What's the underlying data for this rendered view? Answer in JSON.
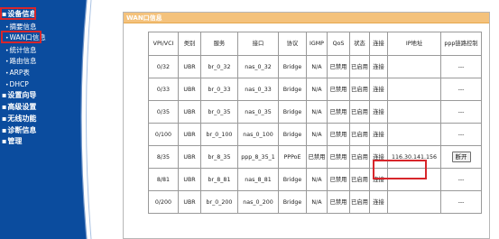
{
  "sidebar": {
    "items": [
      {
        "label": "设备信息",
        "level": "top",
        "bullet": "▪"
      },
      {
        "label": "摘要信息",
        "level": "sub",
        "bullet": "•"
      },
      {
        "label": "WAN口信息",
        "level": "sub",
        "bullet": "•"
      },
      {
        "label": "统计信息",
        "level": "sub",
        "bullet": "•"
      },
      {
        "label": "路由信息",
        "level": "sub",
        "bullet": "•"
      },
      {
        "label": "ARP表",
        "level": "sub",
        "bullet": "•"
      },
      {
        "label": "DHCP",
        "level": "sub",
        "bullet": "•"
      },
      {
        "label": "设置向导",
        "level": "top",
        "bullet": "▪"
      },
      {
        "label": "高级设置",
        "level": "top",
        "bullet": "▪"
      },
      {
        "label": "无线功能",
        "level": "top",
        "bullet": "▪"
      },
      {
        "label": "诊断信息",
        "level": "top",
        "bullet": "▪"
      },
      {
        "label": "管理",
        "level": "top",
        "bullet": "▪"
      }
    ]
  },
  "panel": {
    "title": "WAN口信息"
  },
  "table": {
    "headers": [
      "VPI/VCI",
      "类别",
      "服务",
      "接口",
      "协议",
      "IGMP",
      "QoS",
      "状态",
      "连接",
      "IP地址",
      "ppp链路控制"
    ],
    "rows": [
      [
        "0/32",
        "UBR",
        "br_0_32",
        "nas_0_32",
        "Bridge",
        "N/A",
        "已禁用",
        "已启用",
        "连接",
        "",
        "---"
      ],
      [
        "0/33",
        "UBR",
        "br_0_33",
        "nas_0_33",
        "Bridge",
        "N/A",
        "已禁用",
        "已启用",
        "连接",
        "",
        "---"
      ],
      [
        "0/35",
        "UBR",
        "br_0_35",
        "nas_0_35",
        "Bridge",
        "N/A",
        "已禁用",
        "已启用",
        "连接",
        "",
        "---"
      ],
      [
        "0/100",
        "UBR",
        "br_0_100",
        "nas_0_100",
        "Bridge",
        "N/A",
        "已禁用",
        "已启用",
        "连接",
        "",
        "---"
      ],
      [
        "8/35",
        "UBR",
        "br_8_35",
        "ppp_8_35_1",
        "PPPoE",
        "已禁用",
        "已禁用",
        "已启用",
        "连接",
        "116.30.141.156",
        "断开"
      ],
      [
        "8/81",
        "UBR",
        "br_8_81",
        "nas_8_81",
        "Bridge",
        "N/A",
        "已禁用",
        "已启用",
        "连接",
        "",
        "---"
      ],
      [
        "0/200",
        "UBR",
        "br_0_200",
        "nas_0_200",
        "Bridge",
        "N/A",
        "已禁用",
        "已启用",
        "连接",
        "",
        "---"
      ]
    ]
  },
  "colors": {
    "sidebar": "#0b4c9e",
    "accent": "#f4c27c",
    "highlight": "#d7262b"
  }
}
